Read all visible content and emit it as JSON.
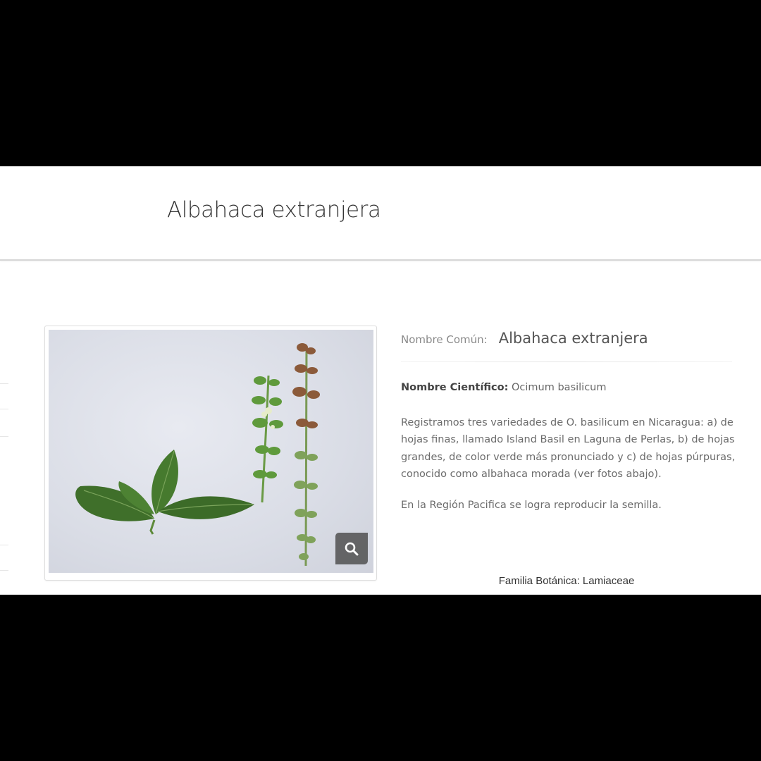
{
  "page_title": "Albahaca extranjera",
  "plant": {
    "common_name_label": "Nombre Común:",
    "common_name": "Albahaca extranjera",
    "scientific_name_label": "Nombre Científico:",
    "scientific_name": "Ocimum basilicum",
    "description": "Registramos tres variedades de O. basilicum en Nicaragua: a) de hojas finas, llamado Island Basil en Laguna de Perlas, b) de hojas grandes, de color verde más pronunciado y c) de hojas púrpuras, conocido como albahaca morada (ver fotos abajo).",
    "note": "En la Región Pacifica se logra reproducir la semilla.",
    "family_label": "Familia Botánica:",
    "family": "Lamiaceae"
  },
  "icons": {
    "zoom": "search-icon"
  },
  "colors": {
    "frame": "#000000",
    "page_background": "#ffffff",
    "zoom_button": "#505050"
  }
}
